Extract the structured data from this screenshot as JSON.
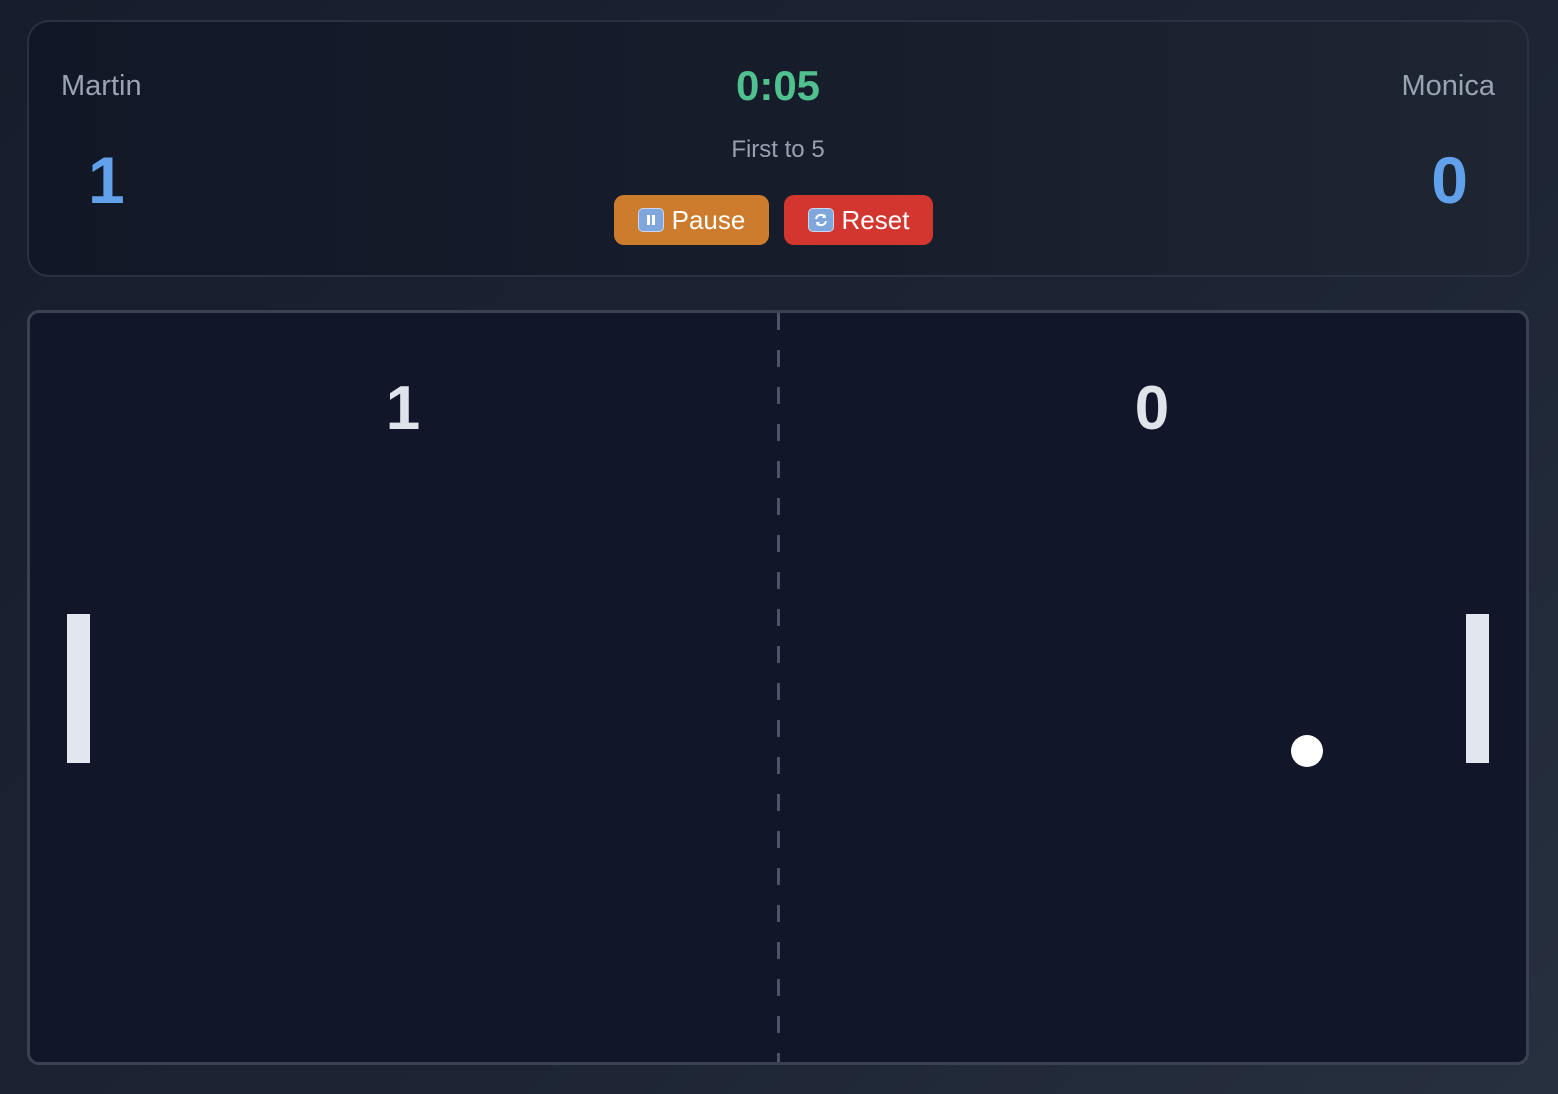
{
  "player1": {
    "name": "Martin",
    "score": "1"
  },
  "player2": {
    "name": "Monica",
    "score": "0"
  },
  "timer": "0:05",
  "target": "First to 5",
  "controls": {
    "pause_label": "Pause",
    "pause_icon": "pause-icon",
    "reset_label": "Reset",
    "reset_icon": "refresh-icon"
  },
  "arena": {
    "left_score": "1",
    "right_score": "0"
  },
  "colors": {
    "score": "#61a0ea",
    "timer": "#50c08e",
    "pause_button": "#cc7c2c",
    "reset_button": "#d3352f"
  }
}
